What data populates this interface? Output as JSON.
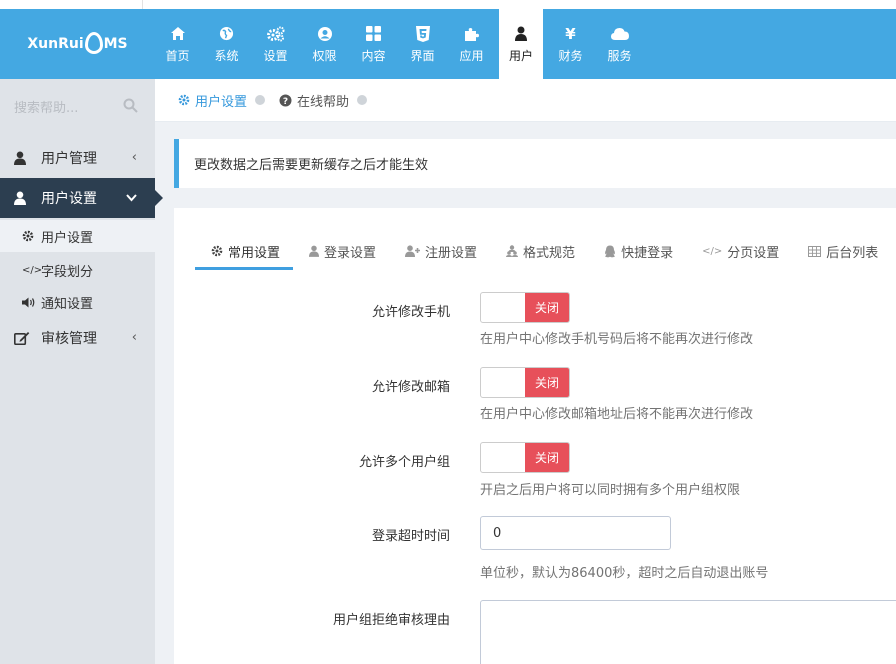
{
  "header": {
    "logo": {
      "left": "XunRui",
      "right": "MS"
    },
    "nav": [
      {
        "label": "首页",
        "icon": "home-icon"
      },
      {
        "label": "系统",
        "icon": "globe-icon"
      },
      {
        "label": "设置",
        "icon": "cogs-icon"
      },
      {
        "label": "权限",
        "icon": "user-circle-icon"
      },
      {
        "label": "内容",
        "icon": "grid-icon"
      },
      {
        "label": "界面",
        "icon": "html5-icon"
      },
      {
        "label": "应用",
        "icon": "puzzle-icon"
      },
      {
        "label": "用户",
        "icon": "user-icon",
        "active": true
      },
      {
        "label": "财务",
        "icon": "yen-icon"
      },
      {
        "label": "服务",
        "icon": "cloud-icon"
      }
    ]
  },
  "sidebar": {
    "search_placeholder": "搜索帮助...",
    "groups": [
      {
        "label": "用户管理",
        "icon": "user-icon",
        "expanded": false
      },
      {
        "label": "用户设置",
        "icon": "user-icon",
        "expanded": true,
        "items": [
          {
            "label": "用户设置",
            "icon": "cog-icon",
            "current": true
          },
          {
            "label": "字段划分",
            "icon": "code-icon"
          },
          {
            "label": "通知设置",
            "icon": "volume-icon"
          }
        ]
      },
      {
        "label": "审核管理",
        "icon": "edit-icon",
        "expanded": false
      }
    ]
  },
  "breadcrumb": {
    "current": "用户设置",
    "help": "在线帮助"
  },
  "alert": {
    "text": "更改数据之后需要更新缓存之后才能生效"
  },
  "tabs": [
    {
      "label": "常用设置",
      "icon": "cog-icon",
      "active": true
    },
    {
      "label": "登录设置",
      "icon": "user-icon"
    },
    {
      "label": "注册设置",
      "icon": "user-plus-icon"
    },
    {
      "label": "格式规范",
      "icon": "users-icon"
    },
    {
      "label": "快捷登录",
      "icon": "qq-icon"
    },
    {
      "label": "分页设置",
      "icon": "code-icon"
    },
    {
      "label": "后台列表",
      "icon": "table-icon"
    }
  ],
  "form": {
    "allow_edit_phone": {
      "label": "允许修改手机",
      "state": "关闭",
      "help": "在用户中心修改手机号码后将不能再次进行修改"
    },
    "allow_edit_email": {
      "label": "允许修改邮箱",
      "state": "关闭",
      "help": "在用户中心修改邮箱地址后将不能再次进行修改"
    },
    "allow_multi_group": {
      "label": "允许多个用户组",
      "state": "关闭",
      "help": "开启之后用户将可以同时拥有多个用户组权限"
    },
    "login_timeout": {
      "label": "登录超时时间",
      "value": "0",
      "help": "单位秒，默认为86400秒，超时之后自动退出账号"
    },
    "group_reject_reason": {
      "label": "用户组拒绝审核理由"
    }
  },
  "colors": {
    "header": "#44a8e2",
    "sidebar_active": "#2c3e50",
    "toggle_off": "#e7505a",
    "link": "#3598dc"
  }
}
